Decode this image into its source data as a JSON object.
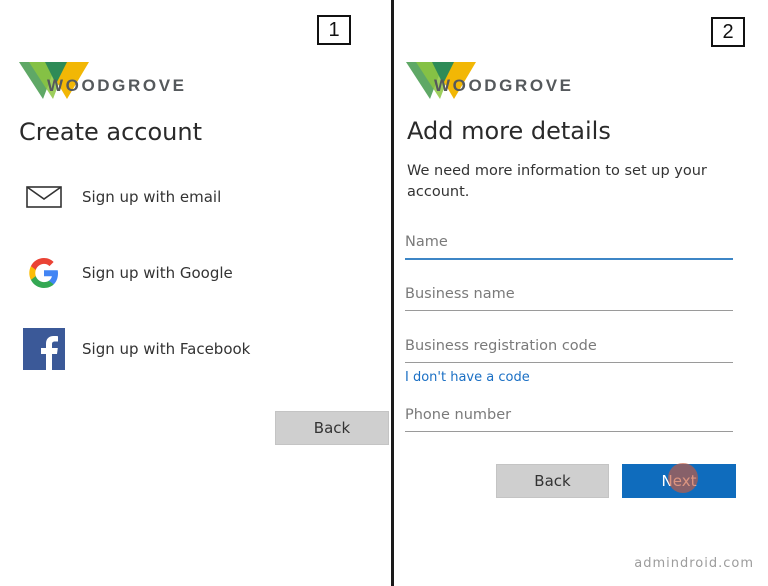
{
  "panel1": {
    "number": "1",
    "logo_text": "WOODGROVE",
    "title": "Create account",
    "options": [
      {
        "label": "Sign up with email",
        "icon": "envelope-icon"
      },
      {
        "label": "Sign up with Google",
        "icon": "google-icon"
      },
      {
        "label": "Sign up with Facebook",
        "icon": "facebook-icon"
      }
    ],
    "back_label": "Back"
  },
  "panel2": {
    "number": "2",
    "logo_text": "WOODGROVE",
    "title": "Add more details",
    "description": "We need more information to set up your account.",
    "fields": [
      {
        "placeholder": "Name",
        "value": ""
      },
      {
        "placeholder": "Business name",
        "value": ""
      },
      {
        "placeholder": "Business registration code",
        "value": ""
      },
      {
        "placeholder": "Phone number",
        "value": ""
      }
    ],
    "no_code_link": "I don't have a code",
    "back_label": "Back",
    "next_label": "Next"
  },
  "watermark": "admindroid.com",
  "colors": {
    "accent_blue": "#0f6cbd",
    "logo_green_dark": "#2e8b57",
    "logo_green_light": "#8cc63f",
    "logo_yellow": "#f2b705"
  }
}
